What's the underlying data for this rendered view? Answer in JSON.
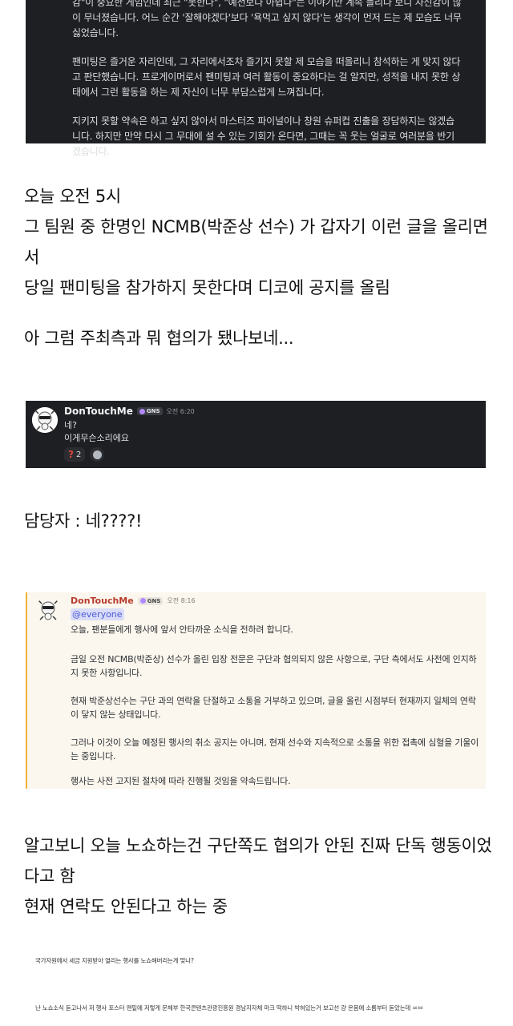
{
  "top_quote": {
    "paragraphs": [
      "감\"이 중요한 게임인데 최근 \"못한다\", \"예전보다 아쉽다\"는 이야기만 계속 들리다 보니 자신감이 많이 무너졌습니다. 어느 순간 '잘해야겠다'보다 '욕먹고 싶지 않다'는 생각이 먼저 드는 제 모습도 너무 싫었습니다.",
      "팬미팅은 즐거운 자리인데, 그 자리에서조차 즐기지 못할 제 모습을 떠올리니 참석하는 게 맞지 않다고 판단했습니다. 프로게이머로서 팬미팅과 여러 활동이 중요하다는 걸 알지만, 성적을 내지 못한 상태에서 그런 활동을 하는 제 자신이 너무 부담스럽게 느껴집니다.",
      "지키지 못할 약속은 하고 싶지 않아서 마스터즈 파이널이나 창원 슈퍼컵 진출을 장담하지는 않겠습니다. 하지만 만약 다시 그 무대에 설 수 있는 기회가 온다면, 그때는 꼭 웃는 얼굴로 여러분을 반기겠습니다."
    ]
  },
  "post": {
    "block1": "오늘 오전 5시\n그 팀원 중 한명인 NCMB(박준상 선수) 가 갑자기 이런 글을 올리면서\n당일 팬미팅을 참가하지 못한다며 디코에 공지를 올림",
    "block2": "아 그럼 주최측과 뭐 협의가 됐나보네...",
    "block3": "담당자 : 네????!",
    "block4": "알고보니 오늘 노쇼하는건 구단쪽도 협의가 안된 진짜 단독 행동이었다고 함\n현재 연락도 안된다고 하는 중"
  },
  "message1": {
    "username": "DonTouchMe",
    "tag": "GNS",
    "time": "오전 6:20",
    "lines": [
      "네?",
      "이게무슨소리에요"
    ],
    "reaction_count": "2"
  },
  "message2": {
    "username": "DonTouchMe",
    "tag": "GNS",
    "time": "오전 8:16",
    "mention": "@everyone",
    "paragraphs": [
      "오늘, 팬분들에게 행사에 앞서 안타까운 소식을 전하려 합니다.",
      "금일 오전 NCMB(박준상) 선수가 올린 입장 전문은 구단과 협의되지 않은 사항으로, 구단 측에서도 사전에 인지하지 못한 사항입니다.",
      "현재 박준상선수는 구단 과의 연락을 단절하고 소통을 거부하고 있으며, 글을 올린 시점부터 현재까지 일체의 연락이 닿지 않는 상태입니다.",
      "그러나 이것이 오늘 예정된 행사의 취소 공지는 아니며, 현재 선수와 지속적으로 소통을 위한 접촉에 심혈을 기울이는 중입니다.",
      "행사는 사전 고지된 절차에 따라 진행될 것임을 약속드립니다."
    ]
  },
  "comments": [
    "국가자원에서 세금 지원받아 열리는 행사를 노쇼해버리는게 맞나?",
    "난 노쇼소식 듣고나서 저 행사 포스터 맨밑에 저렇게 문체부 한국콘텐츠관광진흥원 경남지자체 마크 떡하니 박혀있는거 보고선 걍 온몸에 소름부터 돋았는데 ㅆㅂ"
  ]
}
